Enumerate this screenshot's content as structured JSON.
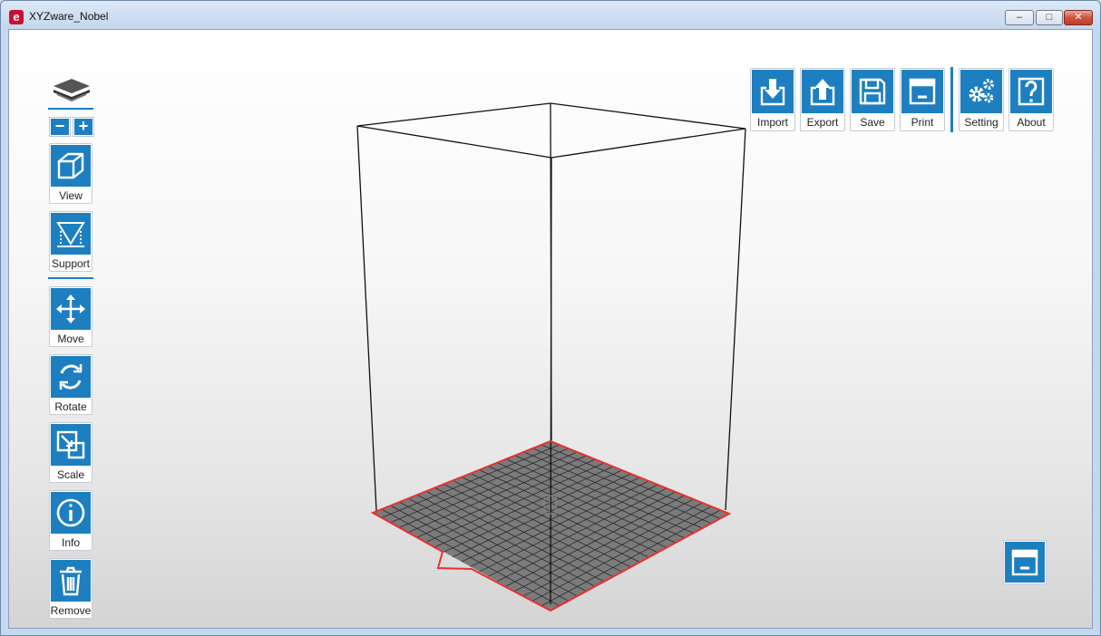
{
  "window": {
    "title": "XYZware_Nobel",
    "min_label": "–",
    "max_label": "□",
    "close_label": "✕"
  },
  "zoom": {
    "out_label": "−",
    "in_label": "+"
  },
  "left_toolbar": {
    "view_label": "View",
    "support_label": "Support",
    "move_label": "Move",
    "rotate_label": "Rotate",
    "scale_label": "Scale",
    "info_label": "Info",
    "remove_label": "Remove"
  },
  "top_toolbar": {
    "import_label": "Import",
    "export_label": "Export",
    "save_label": "Save",
    "print_label": "Print",
    "setting_label": "Setting",
    "about_label": "About"
  },
  "icons": {
    "app": "xyz-logo-icon",
    "layers": "layers-icon",
    "view": "cube-icon",
    "support": "support-icon",
    "move": "move-arrows-icon",
    "rotate": "rotate-icon",
    "scale": "scale-icon",
    "info": "info-icon",
    "remove": "trash-icon",
    "import": "import-icon",
    "export": "export-icon",
    "save": "save-icon",
    "print": "print-icon",
    "setting": "gears-icon",
    "about": "help-icon",
    "preview": "preview-window-icon"
  },
  "colors": {
    "accent": "#1e7fc0",
    "bed_fill": "#7b7b7b",
    "bed_border": "#e8312e",
    "frame": "#111111"
  }
}
